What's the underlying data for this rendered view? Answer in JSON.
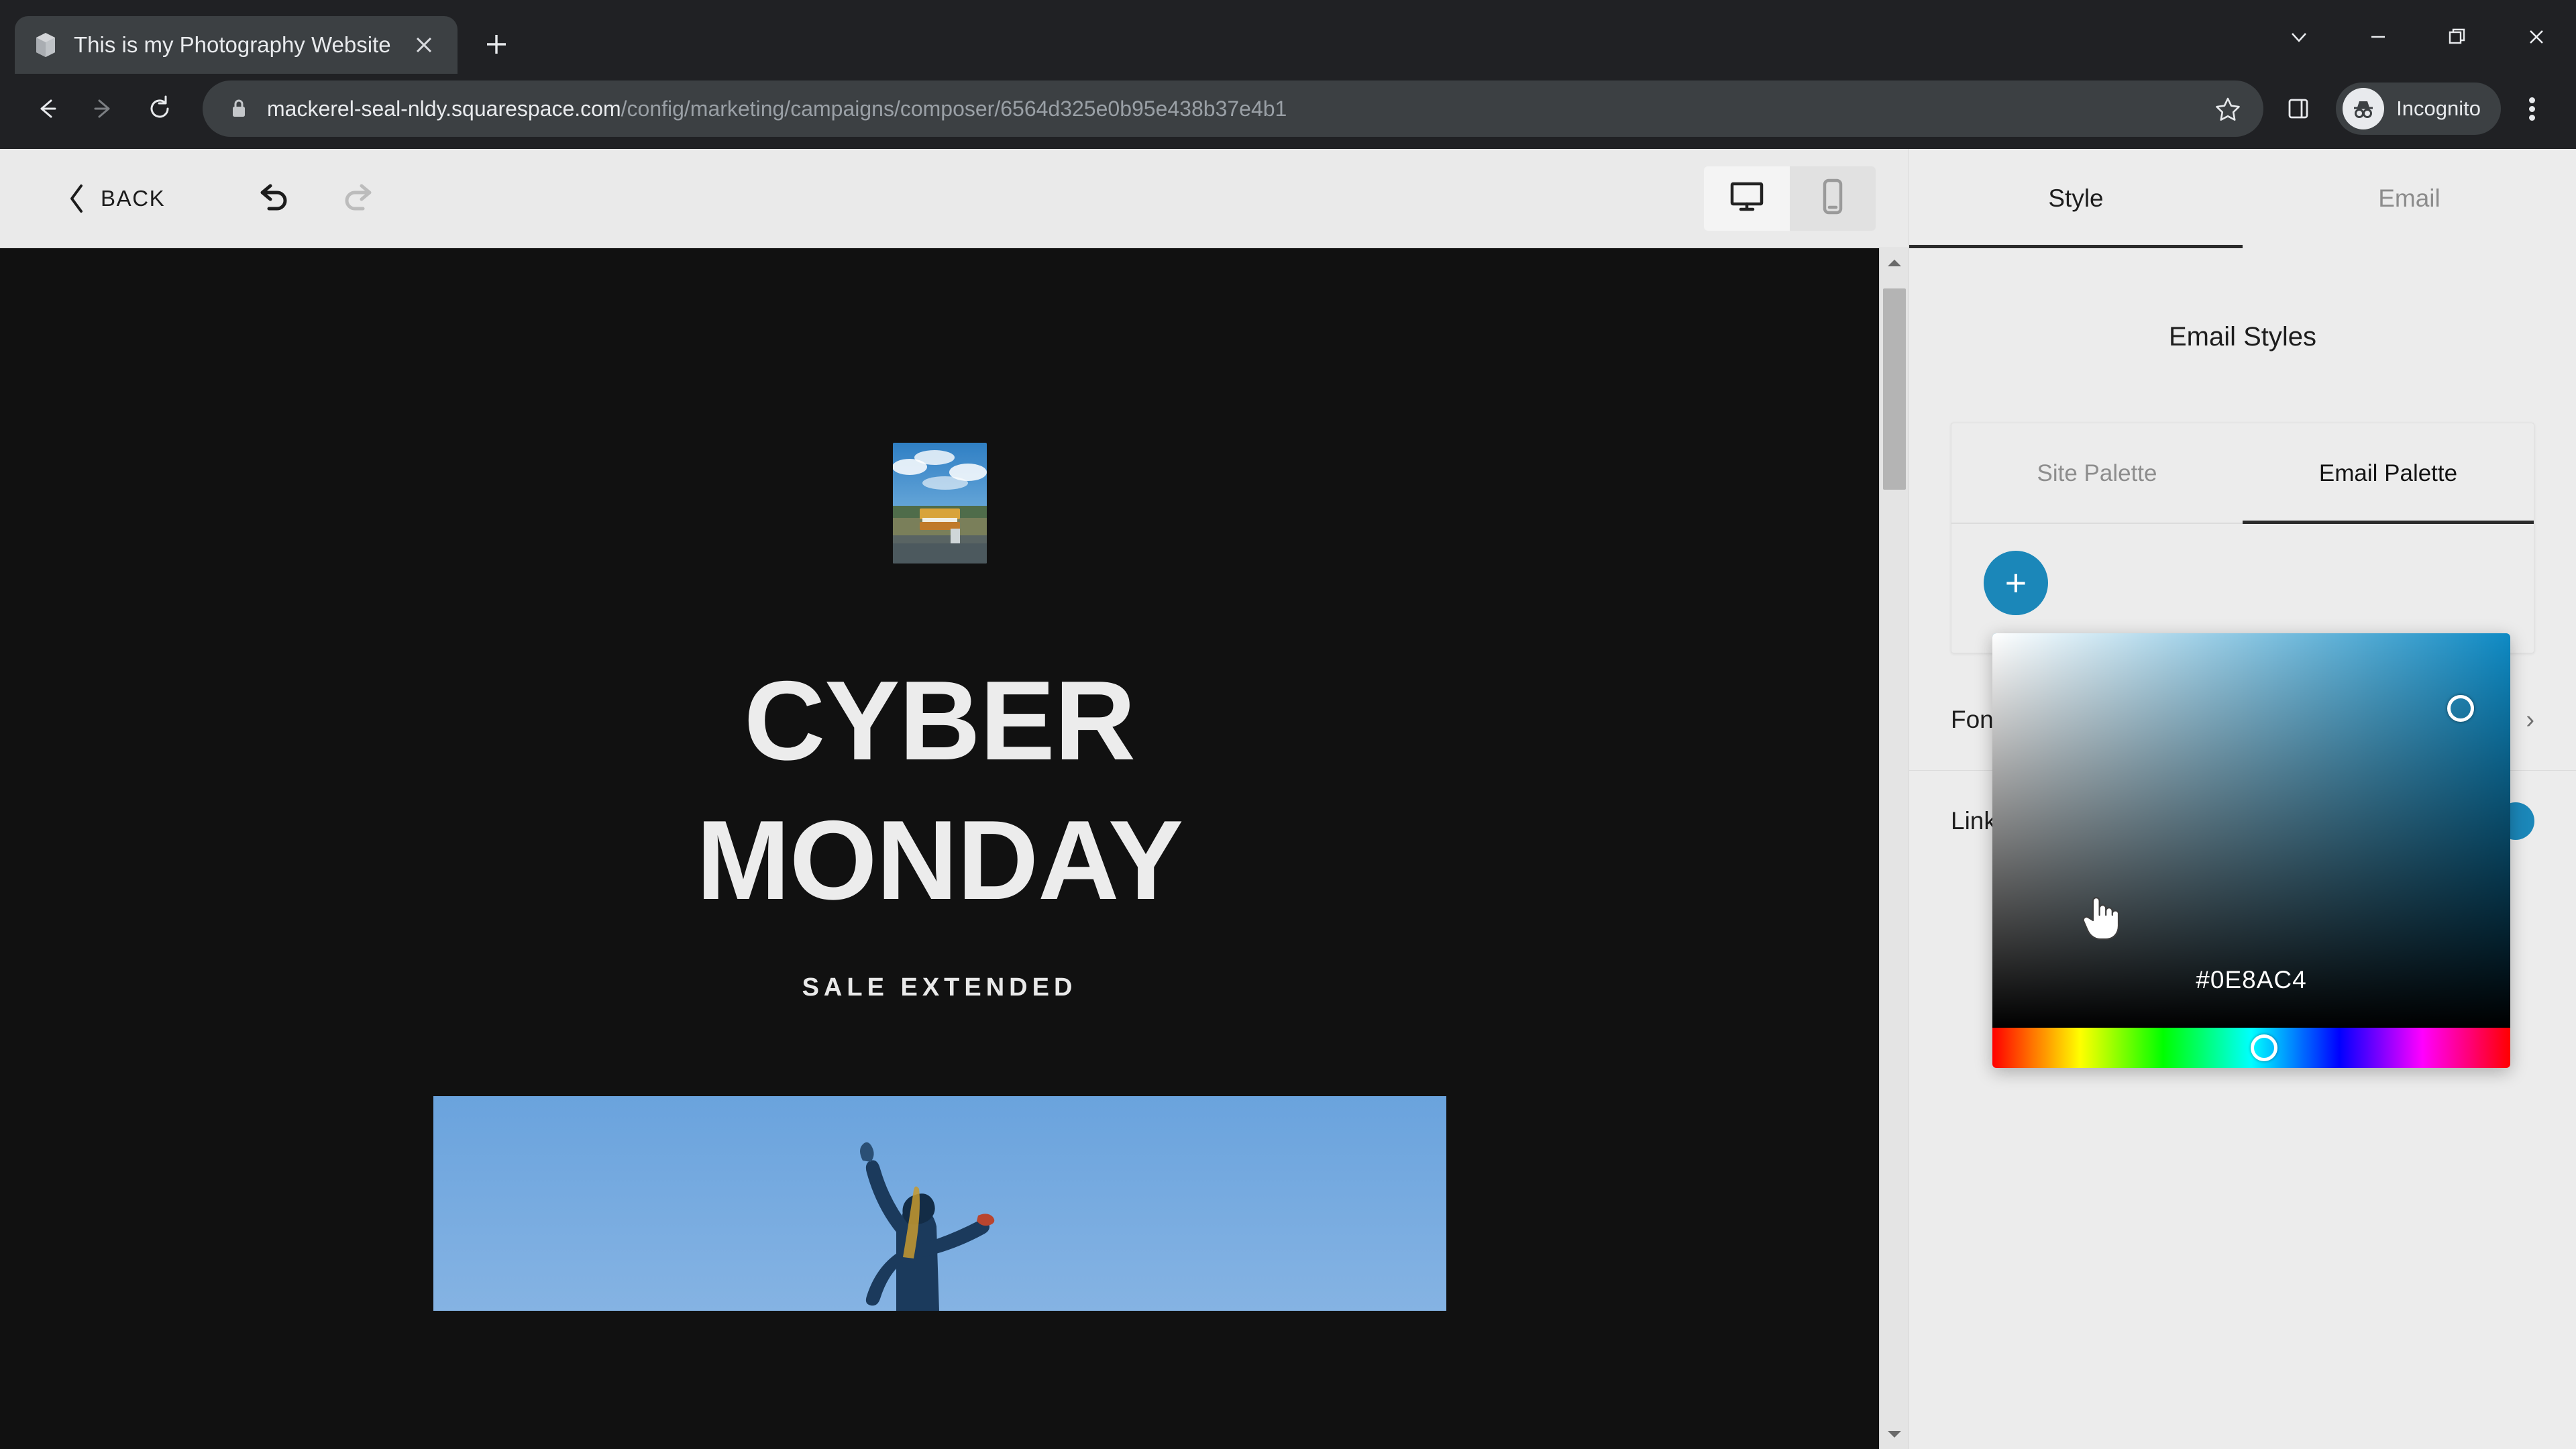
{
  "browser": {
    "tab": {
      "title": "This is my Photography Website",
      "favicon_icon": "cube-icon",
      "close_icon": "close-icon"
    },
    "new_tab_label": "+",
    "window_controls": {
      "tab_search_icon": "chevron-down-icon",
      "minimize_icon": "minimize-icon",
      "restore_icon": "restore-icon",
      "close_icon": "close-icon"
    },
    "nav": {
      "back_icon": "arrow-left-icon",
      "forward_icon": "arrow-right-icon",
      "reload_icon": "reload-icon"
    },
    "omnibox": {
      "lock_icon": "lock-icon",
      "host": "mackerel-seal-nldy.squarespace.com",
      "path": "/config/marketing/campaigns/composer/6564d325e0b95e438b37e4b1",
      "star_icon": "star-icon",
      "side_panel_icon": "side-panel-icon"
    },
    "profile": {
      "label": "Incognito",
      "avatar_icon": "incognito-icon"
    },
    "menu_icon": "kebab-menu-icon"
  },
  "editor": {
    "back_label": "BACK",
    "back_icon": "chevron-left-icon",
    "undo_icon": "undo-icon",
    "redo_icon": "redo-icon",
    "device_toggle": {
      "desktop_icon": "monitor-icon",
      "mobile_icon": "phone-icon",
      "active": "desktop"
    }
  },
  "email": {
    "logo_alt": "temple-photo",
    "headline_line1": "CYBER",
    "headline_line2": "MONDAY",
    "subhead": "SALE EXTENDED",
    "photo_alt": "dancer-photo",
    "background_color": "#111111",
    "text_color": "#ECECEC"
  },
  "scrollbar": {
    "up_icon": "triangle-up-icon",
    "down_icon": "triangle-down-icon"
  },
  "style_panel": {
    "tabs": [
      {
        "label": "Style",
        "active": true
      },
      {
        "label": "Email",
        "active": false
      }
    ],
    "title": "Email Styles",
    "palette": {
      "tabs": [
        {
          "label": "Site Palette",
          "active": false
        },
        {
          "label": "Email Palette",
          "active": true
        }
      ],
      "add_swatch_label": "+",
      "add_swatch_color": "#1B87B9"
    },
    "color_picker": {
      "hex": "#0E8AC4",
      "base_color": "#0E8AC4"
    },
    "rows": [
      {
        "label": "Font Sizes",
        "control": "chevron-right",
        "chevron": "›"
      },
      {
        "label": "Link Color",
        "control": "swatch",
        "swatch_color": "#1B87B9"
      }
    ]
  },
  "cursor": {
    "type": "pointer-hand"
  }
}
